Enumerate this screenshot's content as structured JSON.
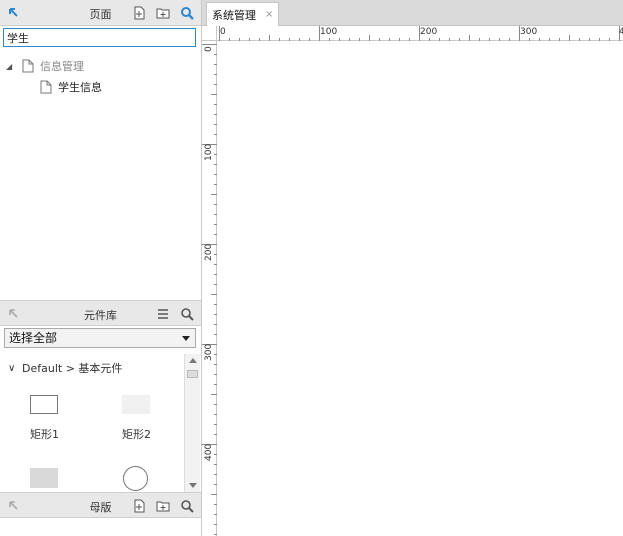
{
  "pages_panel": {
    "title": "页面",
    "search_value": "学生",
    "tree": [
      {
        "label": "信息管理",
        "level": 0,
        "expanded": true
      },
      {
        "label": "学生信息",
        "level": 1
      }
    ]
  },
  "widget_panel": {
    "title": "元件库",
    "library_select": "选择全部",
    "group_label": "Default > 基本元件",
    "widgets": [
      {
        "label": "矩形1"
      },
      {
        "label": "矩形2"
      }
    ]
  },
  "master_panel": {
    "title": "母版"
  },
  "editor": {
    "tab_label": "系统管理",
    "tab_close": "×",
    "h_ruler_labels": [
      "0",
      "100",
      "200",
      "300",
      "4"
    ],
    "v_ruler_labels": [
      "0",
      "100",
      "200",
      "300",
      "400"
    ]
  },
  "colors": {
    "accent": "#2e88d0",
    "panel_header": "#e8e8e8",
    "tab_bar": "#dadada"
  }
}
